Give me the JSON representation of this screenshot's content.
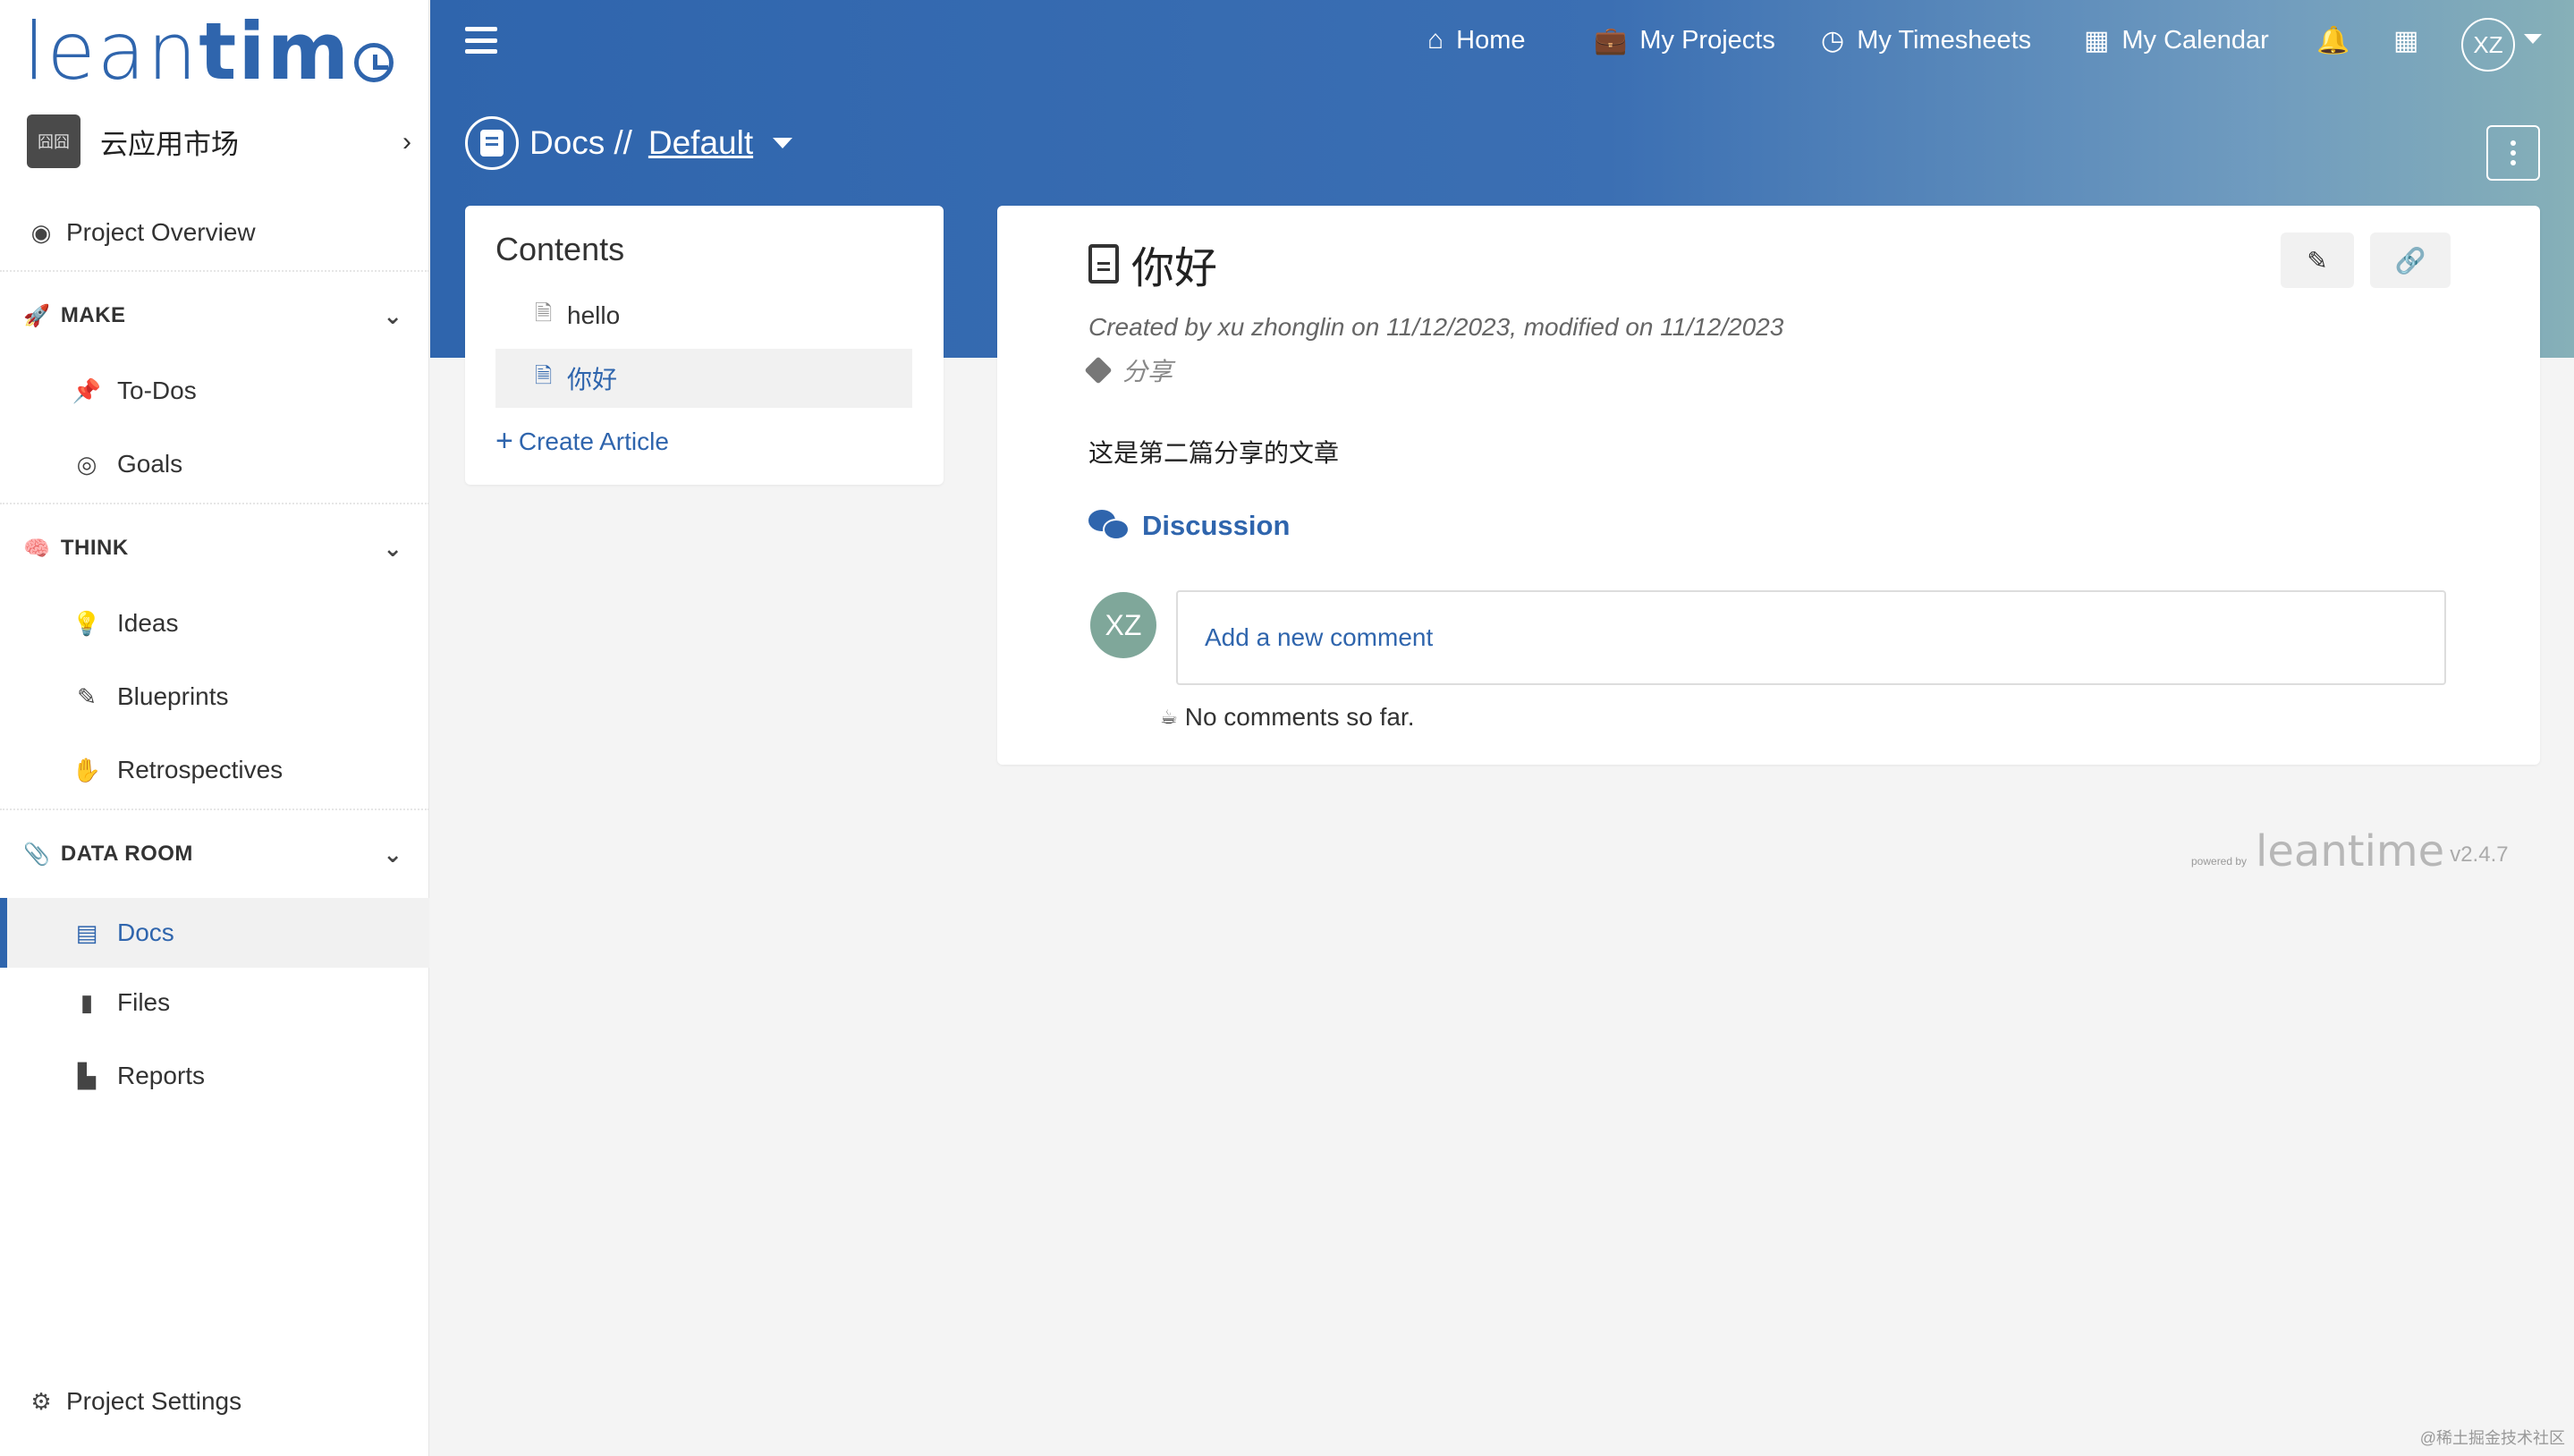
{
  "logo": {
    "part1": "lean",
    "part2": "tim"
  },
  "project": {
    "thumb_label": "囧囧",
    "name": "云应用市场"
  },
  "sidebar": {
    "project_overview": "Project Overview",
    "sections": [
      {
        "label": "MAKE",
        "items": [
          "To-Dos",
          "Goals"
        ]
      },
      {
        "label": "THINK",
        "items": [
          "Ideas",
          "Blueprints",
          "Retrospectives"
        ]
      },
      {
        "label": "DATA ROOM",
        "items": [
          "Docs",
          "Files",
          "Reports"
        ]
      }
    ],
    "project_settings": "Project Settings"
  },
  "topnav": {
    "home": "Home",
    "my_projects": "My Projects",
    "my_timesheets": "My Timesheets",
    "my_calendar": "My Calendar",
    "user_initials": "XZ"
  },
  "breadcrumb": {
    "module": "Docs",
    "separator": "//",
    "board": "Default"
  },
  "contents": {
    "title": "Contents",
    "items": [
      "hello",
      "你好"
    ],
    "active_index": 1,
    "create_label": "Create Article"
  },
  "article": {
    "title": "你好",
    "meta": "Created by xu zhonglin on 11/12/2023, modified on 11/12/2023",
    "tag": "分享",
    "body": "这是第二篇分享的文章",
    "discussion_label": "Discussion",
    "commenter_initials": "XZ",
    "comment_placeholder": "Add a new comment",
    "no_comments": "No comments so far."
  },
  "footer": {
    "powered_by": "powered by",
    "logo_text": "leantime",
    "version": "v2.4.7"
  },
  "watermark": "@稀土掘金技术社区",
  "colors": {
    "brand": "#2f65ad",
    "header_end": "#86b0b8",
    "background": "#f4f4f4"
  }
}
